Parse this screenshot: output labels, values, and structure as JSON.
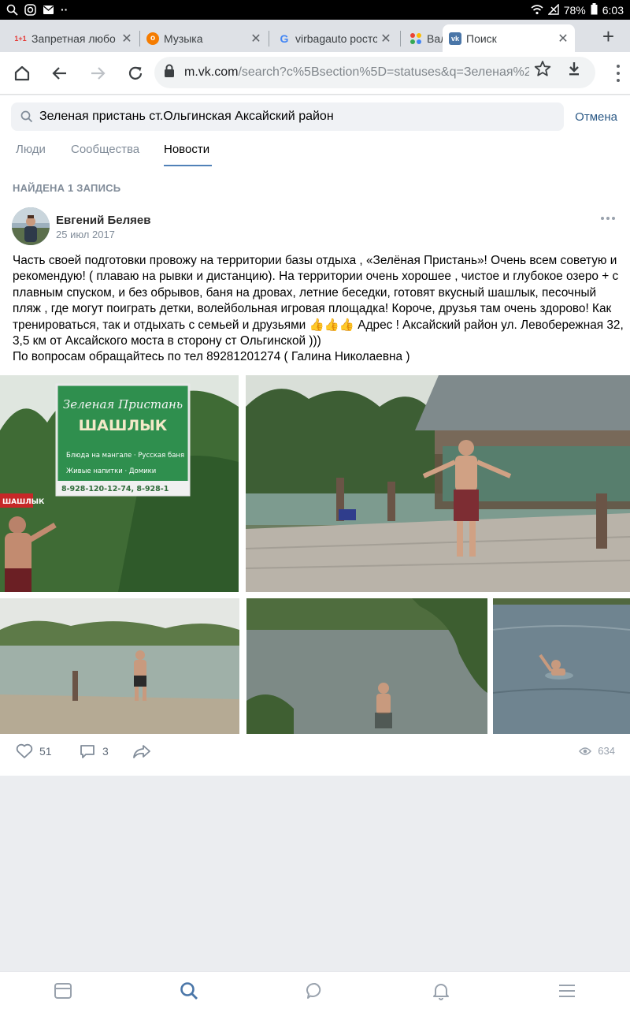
{
  "status": {
    "battery": "78%",
    "time": "6:03"
  },
  "browser": {
    "tabs": [
      {
        "label": "Запретная любо",
        "fav": "1+1",
        "fav_color": "#e53935"
      },
      {
        "label": "Музыка",
        "fav": "ok",
        "fav_color": "#f57c00"
      },
      {
        "label": "virbagauto росто",
        "fav": "G",
        "fav_color": "#4285f4"
      },
      {
        "label": "Вал",
        "fav": "",
        "fav_color": "#34a853"
      },
      {
        "label": "Поиск",
        "fav": "vk",
        "fav_color": "#4a76a8"
      }
    ],
    "url_host": "m.vk.com",
    "url_path": "/search?c%5Bsection%5D=statuses&q=Зеленая%2"
  },
  "search": {
    "query": "Зеленая пристань ст.Ольгинская Аксайский район",
    "cancel": "Отмена"
  },
  "vk_tabs": [
    "Люди",
    "Сообщества",
    "Новости"
  ],
  "found_label": "НАЙДЕНА 1 ЗАПИСЬ",
  "post": {
    "author": "Евгений Беляев",
    "date": "25 июл 2017",
    "text_lines": [
      "Часть своей подготовки провожу на территории базы отдыха , «Зелёная Пристань»! Очень всем советую и",
      "рекомендую! ( плаваю на рывки и дистанцию). На территории очень хорошее , чистое и глубокое озеро + с",
      "плавным спуском, и без обрывов, баня на дровах, летние беседки, готовят вкусный шашлык, песочный",
      "пляж , где могут поиграть детки, волейбольная игровая площадка! Короче, друзья там очень здорово! Как",
      "тренироваться, так и отдыхать с семьей и друзьями 👍👍👍 Адрес ! Аксайский район ул. Левобережная 32,",
      "3,5 км от Аксайского моста в сторону ст Ольгинской )))",
      "По вопросам обращайтесь по тел 89281201274 ( Галина Николаевна )"
    ],
    "sign": {
      "title": "Зеленая Пристань",
      "big": "ШАШЛЫК",
      "line1": "Блюда на мангале · Русская баня",
      "line2": "Живые напитки · Домики",
      "phone": "8-928-120-12-74, 8-928-1",
      "side": "ШАШЛЫК"
    },
    "likes": "51",
    "comments": "3",
    "views": "634"
  }
}
